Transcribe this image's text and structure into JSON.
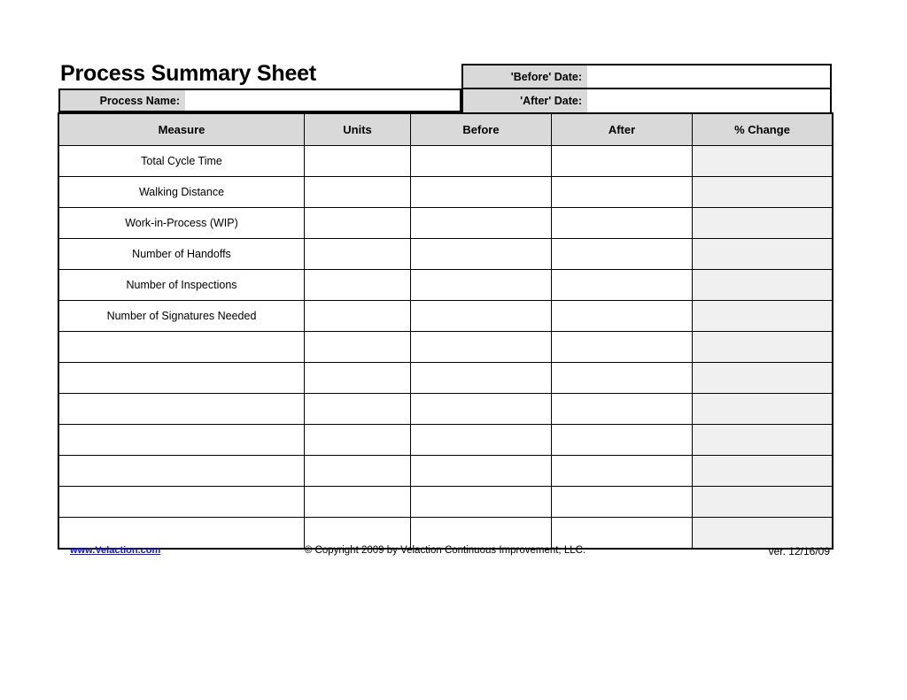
{
  "document": {
    "title": "Process Summary Sheet"
  },
  "info": {
    "process_name_label": "Process Name:",
    "process_name_value": "",
    "before_date_label": "'Before' Date:",
    "before_date_value": "",
    "after_date_label": "'After' Date:",
    "after_date_value": ""
  },
  "table": {
    "columns": [
      "Measure",
      "Units",
      "Before",
      "After",
      "% Change"
    ],
    "rows": [
      {
        "measure": "Total Cycle Time",
        "units": "",
        "before": "",
        "after": "",
        "pct_change": ""
      },
      {
        "measure": "Walking Distance",
        "units": "",
        "before": "",
        "after": "",
        "pct_change": ""
      },
      {
        "measure": "Work-in-Process (WIP)",
        "units": "",
        "before": "",
        "after": "",
        "pct_change": ""
      },
      {
        "measure": "Number of Handoffs",
        "units": "",
        "before": "",
        "after": "",
        "pct_change": ""
      },
      {
        "measure": "Number of Inspections",
        "units": "",
        "before": "",
        "after": "",
        "pct_change": ""
      },
      {
        "measure": "Number of Signatures Needed",
        "units": "",
        "before": "",
        "after": "",
        "pct_change": ""
      },
      {
        "measure": "",
        "units": "",
        "before": "",
        "after": "",
        "pct_change": ""
      },
      {
        "measure": "",
        "units": "",
        "before": "",
        "after": "",
        "pct_change": ""
      },
      {
        "measure": "",
        "units": "",
        "before": "",
        "after": "",
        "pct_change": ""
      },
      {
        "measure": "",
        "units": "",
        "before": "",
        "after": "",
        "pct_change": ""
      },
      {
        "measure": "",
        "units": "",
        "before": "",
        "after": "",
        "pct_change": ""
      },
      {
        "measure": "",
        "units": "",
        "before": "",
        "after": "",
        "pct_change": ""
      },
      {
        "measure": "",
        "units": "",
        "before": "",
        "after": "",
        "pct_change": ""
      }
    ]
  },
  "footer": {
    "link": "www.Velaction.com",
    "copyright": "© Copyright 2009 by Velaction Continuous Improvement, LLC.",
    "version": "ver. 12/16/09"
  },
  "colors": {
    "header_fill": "#d9d9d9",
    "pct_change_fill": "#f0f0f0",
    "link": "#1414e6",
    "border": "#000000",
    "page": "#ffffff"
  }
}
